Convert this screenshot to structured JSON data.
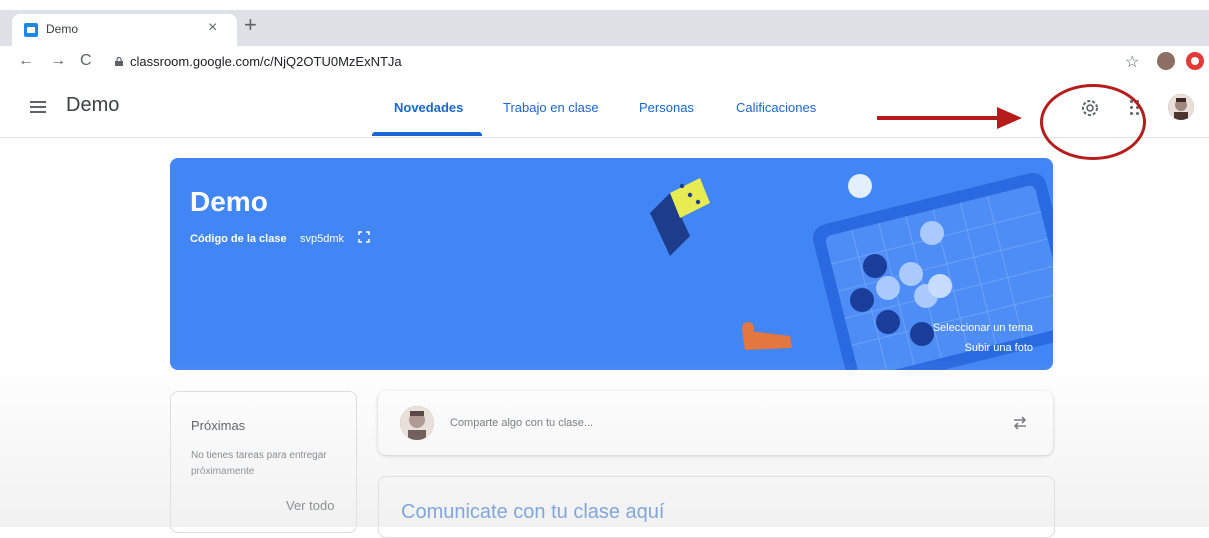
{
  "browser": {
    "tab_title": "Demo",
    "tab_close": "×",
    "new_tab": "+",
    "url": "classroom.google.com/c/NjQ2OTU0MzExNTJa",
    "back": "←",
    "forward": "→",
    "reload": "C",
    "star": "☆"
  },
  "header": {
    "title": "Demo",
    "tabs": [
      {
        "label": "Novedades"
      },
      {
        "label": "Trabajo en clase"
      },
      {
        "label": "Personas"
      },
      {
        "label": "Calificaciones"
      }
    ]
  },
  "banner": {
    "title": "Demo",
    "code_label": "Código de la clase",
    "code": "svp5dmk",
    "select_theme": "Seleccionar un tema",
    "upload_photo": "Subir una foto"
  },
  "upcoming": {
    "title": "Próximas",
    "text": "No tienes tareas para entregar próximamente",
    "link": "Ver todo"
  },
  "stream": {
    "share_placeholder": "Comparte algo con tu clase...",
    "announce_title": "Comunicate con tu clase aquí"
  },
  "colors": {
    "accent": "#1967d2",
    "banner": "#4285f4",
    "annotation": "#b71c1c"
  }
}
